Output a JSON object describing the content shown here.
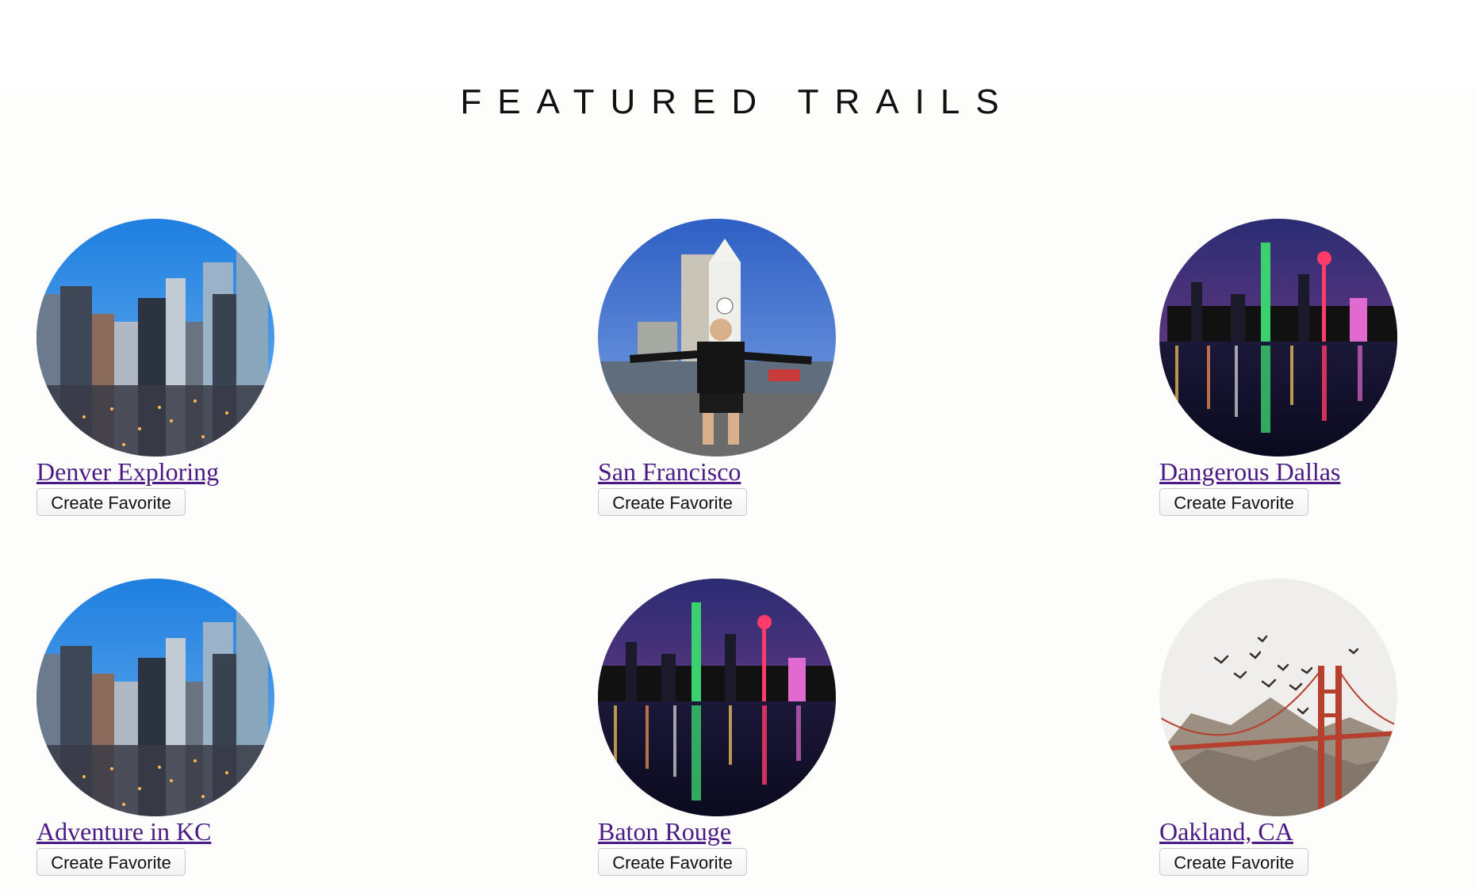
{
  "page": {
    "title": "FEATURED TRAILS"
  },
  "trails": [
    {
      "name": "Denver Exploring",
      "button_label": "Create Favorite",
      "image": "city-skyline-day-photo"
    },
    {
      "name": "San Francisco",
      "button_label": "Create Favorite",
      "image": "person-at-ferry-building-photo"
    },
    {
      "name": "Dangerous Dallas",
      "button_label": "Create Favorite",
      "image": "night-skyline-reflection-photo"
    },
    {
      "name": "Adventure in KC",
      "button_label": "Create Favorite",
      "image": "city-skyline-day-photo"
    },
    {
      "name": "Baton Rouge",
      "button_label": "Create Favorite",
      "image": "night-skyline-reflection-photo"
    },
    {
      "name": "Oakland, CA",
      "button_label": "Create Favorite",
      "image": "golden-gate-bridge-birds-photo"
    }
  ],
  "colors": {
    "link": "#4b1a86",
    "background": "#fdfefc"
  }
}
